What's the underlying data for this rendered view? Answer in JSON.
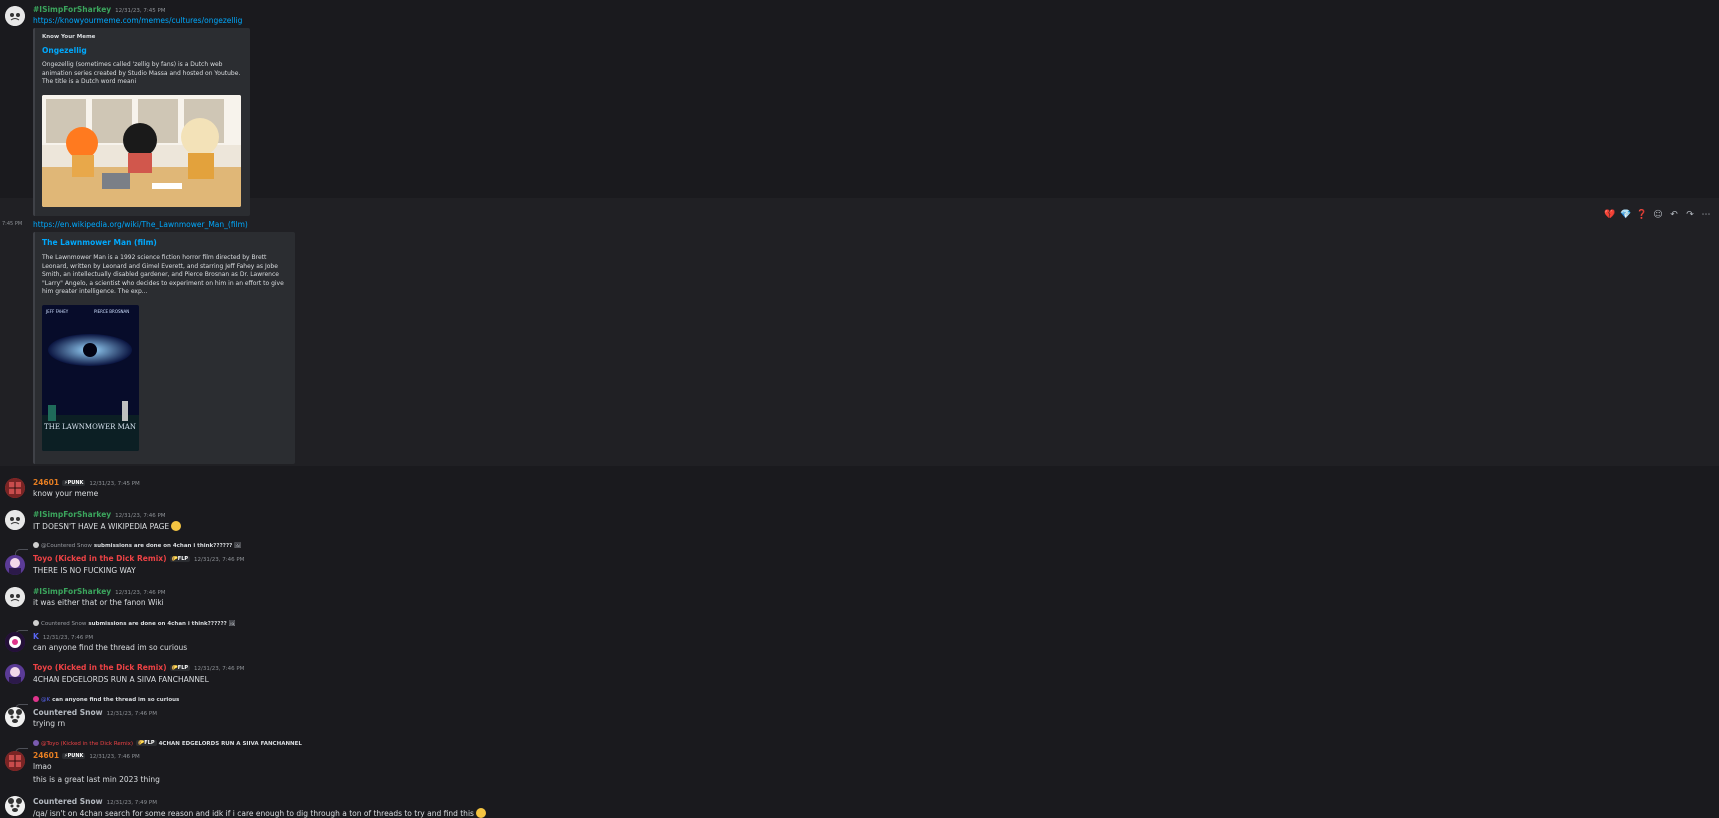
{
  "messages": [
    {
      "user": "#ISimpForSharkey",
      "time": "12/31/23, 7:45 PM",
      "link": "https://knowyourmeme.com/memes/cultures/ongezellig"
    },
    {
      "time": "7:45 PM",
      "link": "https://en.wikipedia.org/wiki/The_Lawnmower_Man_(film)"
    },
    {
      "user": "24601",
      "tag": "⚡PUNK",
      "time": "12/31/23, 7:45 PM",
      "text": "know your meme"
    },
    {
      "user": "#ISimpForSharkey",
      "time": "12/31/23, 7:46 PM",
      "text": "IT DOESN'T HAVE A WIKIPEDIA PAGE"
    },
    {
      "reply_name": "@Countered Snow",
      "reply_text": "submissions are done on 4chan i think??????",
      "user": "Toyo (Kicked in the Dick Remix)",
      "tag": "🌮FLP",
      "time": "12/31/23, 7:46 PM",
      "text": "THERE IS NO FUCKING WAY"
    },
    {
      "user": "#ISimpForSharkey",
      "time": "12/31/23, 7:46 PM",
      "text": "it was either that or the fanon Wiki"
    },
    {
      "reply_name": "Countered Snow",
      "reply_text": "submissions are done on 4chan i think??????",
      "user": "K",
      "time": "12/31/23, 7:46 PM",
      "text": "can anyone find the thread im so curious"
    },
    {
      "user": "Toyo (Kicked in the Dick Remix)",
      "tag": "🌮FLP",
      "time": "12/31/23, 7:46 PM",
      "text": "4CHAN EDGELORDS RUN A SIIVA FANCHANNEL"
    },
    {
      "reply_name": "@K",
      "reply_text": "can anyone find the thread im so curious",
      "user": "Countered Snow",
      "time": "12/31/23, 7:46 PM",
      "text": "trying rn"
    },
    {
      "reply_name": "@Toyo (Kicked in the Dick Remix)",
      "reply_tag": "🌮FLP",
      "reply_text": "4CHAN EDGELORDS RUN A SIIVA FANCHANNEL",
      "user": "24601",
      "tag": "⚡PUNK",
      "time": "12/31/23, 7:46 PM",
      "text": "lmao",
      "text2": "this is a great last min 2023 thing"
    },
    {
      "user": "Countered Snow",
      "time": "12/31/23, 7:49 PM",
      "text": "/qa/ isn't on 4chan search for some reason and idk if i care enough to dig through a ton of threads to try and find this"
    }
  ],
  "embeds": {
    "kym": {
      "provider": "Know Your Meme",
      "title": "Ongezellig",
      "desc": "Ongezellig (sometimes called 'zellig by fans) is a Dutch web animation series created by Studio Massa and hosted on Youtube. The title is a Dutch word meani"
    },
    "wiki": {
      "title": "The Lawnmower Man (film)",
      "desc": "The Lawnmower Man is a 1992 science fiction horror film directed by Brett Leonard, written by Leonard and Gimel Everett, and starring Jeff Fahey as Jobe Smith, an intellectually disabled gardener, and Pierce Brosnan as Dr. Lawrence \"Larry\" Angelo, a scientist who decides to experiment on him in an effort to give him greater intelligence. The exp...",
      "poster_top_left": "JEFF FAHEY",
      "poster_top_right": "PIERCE BROSNAN",
      "poster_title": "THE LAWNMOWER MAN"
    }
  },
  "colors": {
    "green": "#3ba55d",
    "orange": "#e67e22",
    "red": "#ed4245",
    "gray": "#b5bac1",
    "blue": "#00a8fc"
  },
  "toolbar_icons": [
    "heart-broken-icon",
    "gem-icon",
    "question-icon",
    "add-reaction-icon",
    "reply-icon",
    "forward-icon",
    "more-icon"
  ]
}
